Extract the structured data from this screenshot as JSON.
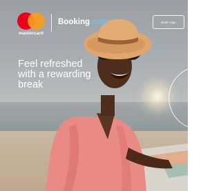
{
  "brand": {
    "mastercard": {
      "wordmark": "mastercard",
      "colors": {
        "red": "#eb001b",
        "yellow": "#f79e1b"
      }
    },
    "booking": {
      "name": "Booking",
      "suffix": ".com",
      "colors": {
        "text": "#ffffff",
        "accent": "#70c3f0"
      }
    }
  },
  "cta": {
    "label": "Book Logo"
  },
  "headline": {
    "lines": [
      "Feel refreshed",
      "with a rewarding",
      "break"
    ]
  }
}
